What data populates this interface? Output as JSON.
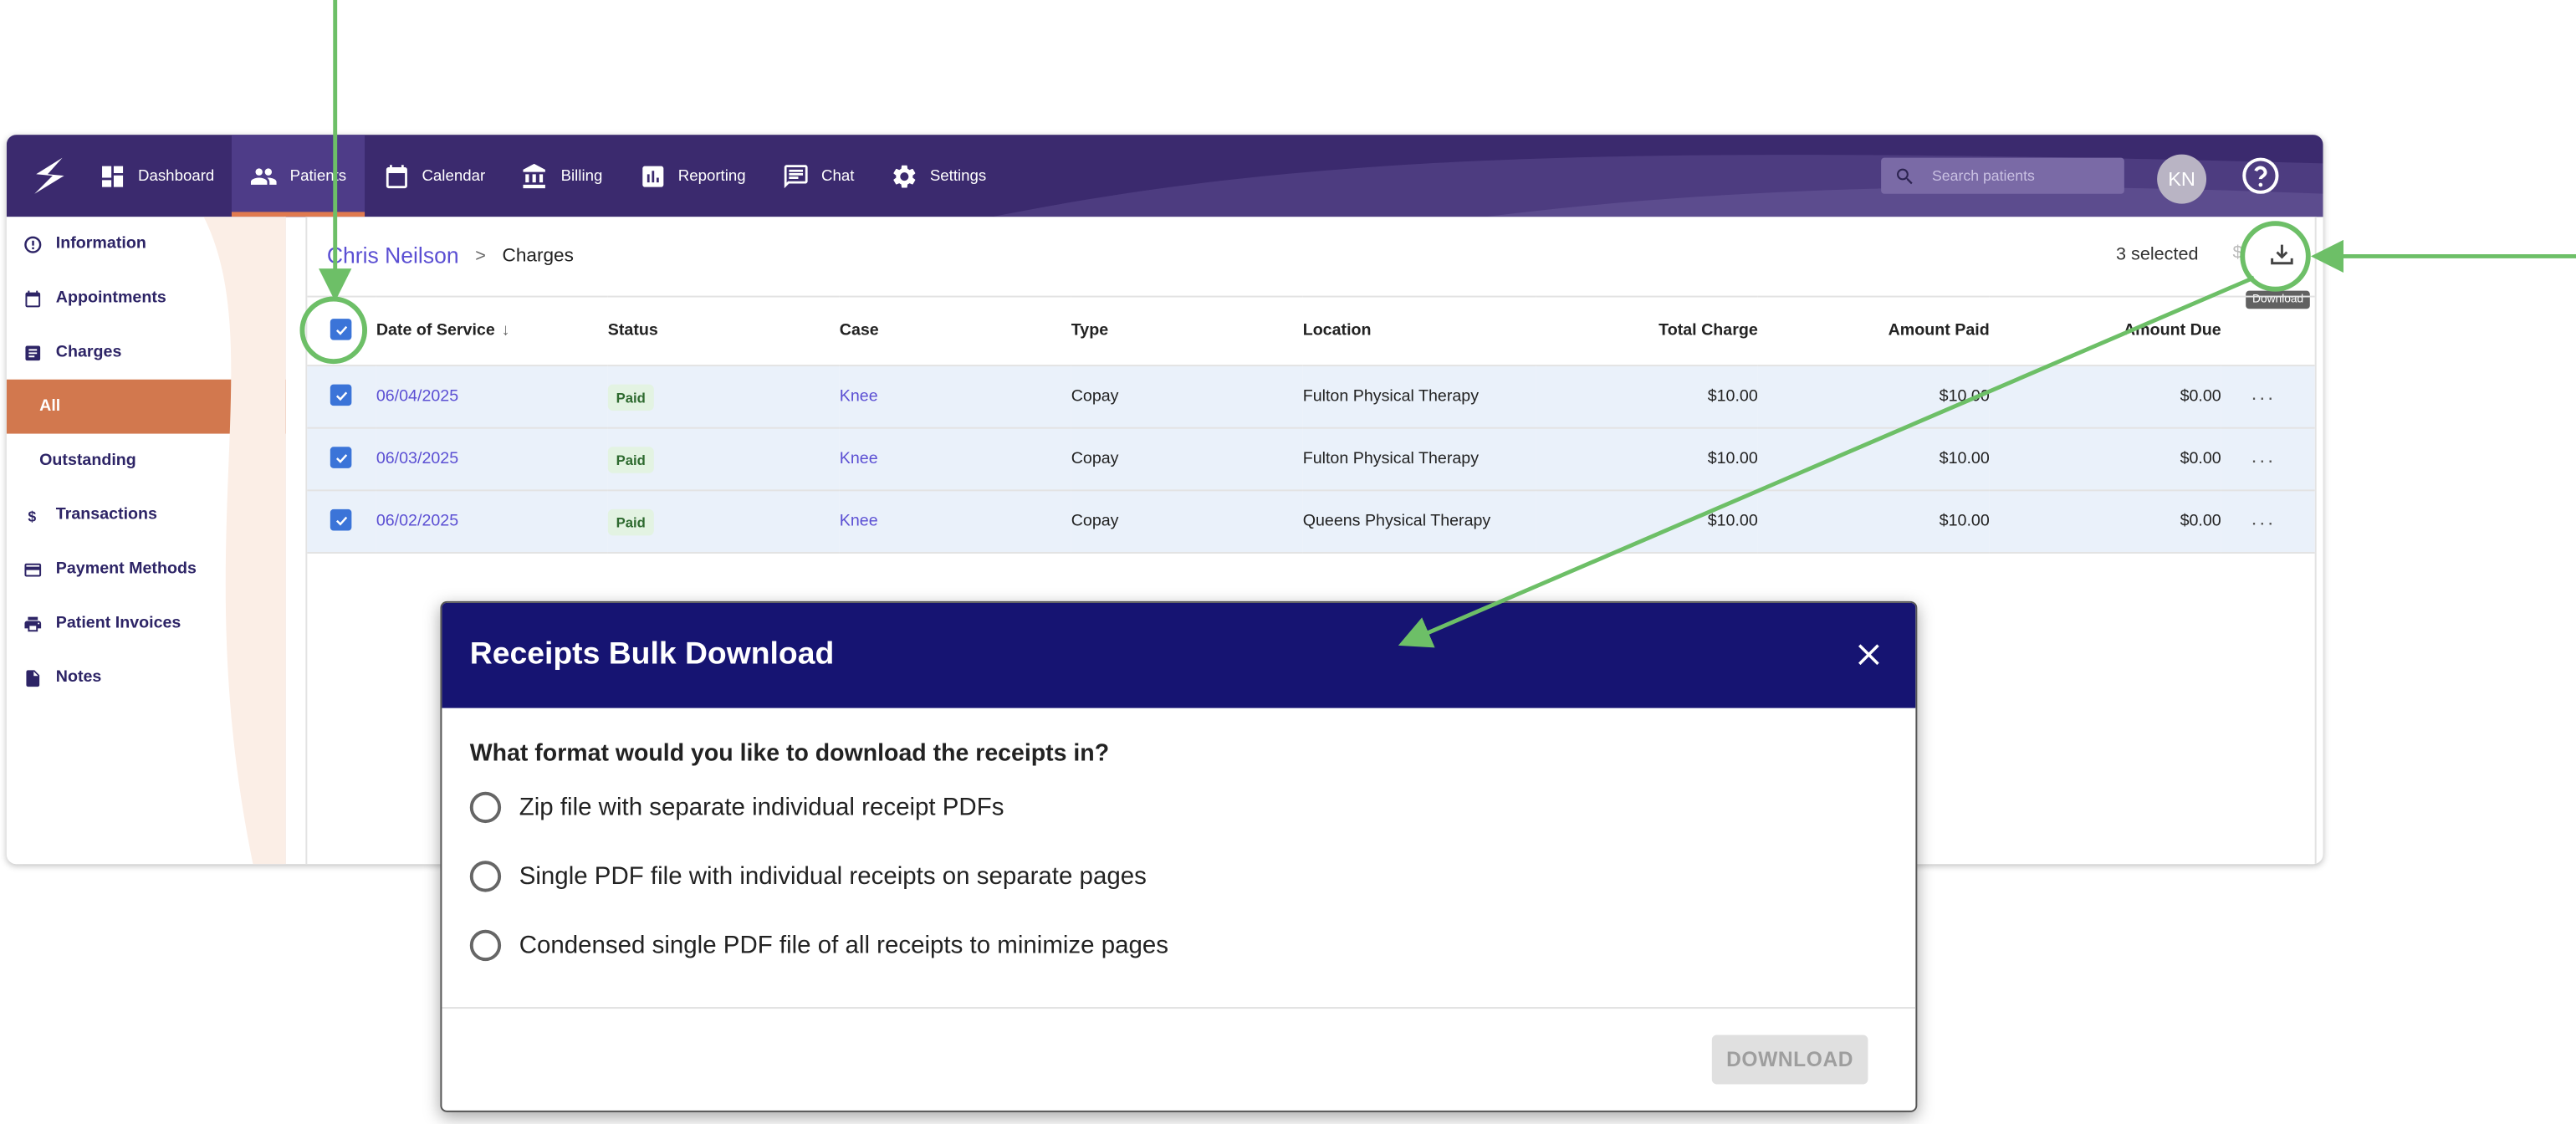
{
  "nav": {
    "items": [
      {
        "label": "Dashboard",
        "icon": "dashboard-icon",
        "active": false
      },
      {
        "label": "Patients",
        "icon": "people-icon",
        "active": true
      },
      {
        "label": "Calendar",
        "icon": "calendar-icon",
        "active": false
      },
      {
        "label": "Billing",
        "icon": "bank-icon",
        "active": false
      },
      {
        "label": "Reporting",
        "icon": "chart-icon",
        "active": false
      },
      {
        "label": "Chat",
        "icon": "chat-icon",
        "active": false
      },
      {
        "label": "Settings",
        "icon": "gear-icon",
        "active": false
      }
    ],
    "search_placeholder": "Search patients",
    "avatar_initials": "KN"
  },
  "sidebar": {
    "items": [
      {
        "label": "Information",
        "icon": "info-icon"
      },
      {
        "label": "Appointments",
        "icon": "calendar-icon"
      },
      {
        "label": "Charges",
        "icon": "list-icon"
      },
      {
        "label": "All"
      },
      {
        "label": "Outstanding"
      },
      {
        "label": "Transactions",
        "icon": "dollar-icon"
      },
      {
        "label": "Payment Methods",
        "icon": "card-icon"
      },
      {
        "label": "Patient Invoices",
        "icon": "printer-icon"
      },
      {
        "label": "Notes",
        "icon": "note-icon"
      }
    ]
  },
  "breadcrumb": {
    "patient": "Chris Neilson",
    "separator": ">",
    "page": "Charges"
  },
  "selection": {
    "count_label": "3 selected",
    "tooltip": "Download"
  },
  "table": {
    "headers": [
      "Date of Service",
      "Status",
      "Case",
      "Type",
      "Location",
      "Total Charge",
      "Amount Paid",
      "Amount Due"
    ],
    "rows": [
      {
        "date": "06/04/2025",
        "status": "Paid",
        "case": "Knee",
        "type": "Copay",
        "location": "Fulton Physical Therapy",
        "total": "$10.00",
        "paid": "$10.00",
        "due": "$0.00",
        "menu": "···"
      },
      {
        "date": "06/03/2025",
        "status": "Paid",
        "case": "Knee",
        "type": "Copay",
        "location": "Fulton Physical Therapy",
        "total": "$10.00",
        "paid": "$10.00",
        "due": "$0.00",
        "menu": "···"
      },
      {
        "date": "06/02/2025",
        "status": "Paid",
        "case": "Knee",
        "type": "Copay",
        "location": "Queens Physical Therapy",
        "total": "$10.00",
        "paid": "$10.00",
        "due": "$0.00",
        "menu": "···"
      }
    ]
  },
  "modal": {
    "title": "Receipts Bulk Download",
    "question": "What format would you like to download the receipts in?",
    "options": [
      "Zip file with separate individual receipt PDFs",
      "Single PDF file with individual receipts on separate pages",
      "Condensed single PDF file of all receipts to minimize pages"
    ],
    "download_label": "DOWNLOAD"
  },
  "colors": {
    "topbar": "#3b2a6e",
    "modal_header": "#161472",
    "accent_orange": "#d2784e",
    "annotation_green": "#6dbf67",
    "link": "#5b4fd3"
  }
}
